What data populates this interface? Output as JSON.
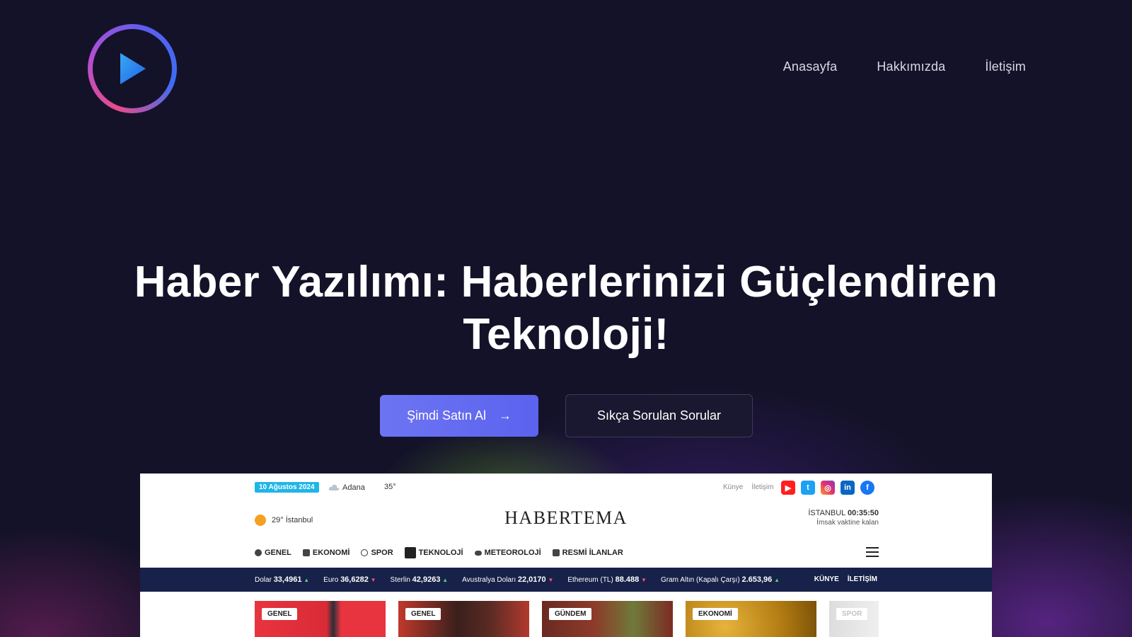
{
  "nav": {
    "items": [
      "Anasayfa",
      "Hakkımızda",
      "İletişim"
    ]
  },
  "hero": {
    "title_line1": "Haber Yazılımı: Haberlerinizi Güçlendiren",
    "title_line2": "Teknoloji!",
    "primary_button": "Şimdi Satın Al",
    "primary_button_arrow": "→",
    "secondary_button": "Sıkça Sorulan Sorular"
  },
  "preview": {
    "date_badge": "10 Ağustos 2024",
    "city": "Adana",
    "temp": "35°",
    "top_links": [
      "Künye",
      "İletişim"
    ],
    "weather": "29° İstanbul",
    "brand": "HABERTEMA",
    "clock_city": "İSTANBUL",
    "clock_time": "00:35:50",
    "clock_caption": "İmsak vaktine kalan",
    "menu": [
      "GENEL",
      "EKONOMİ",
      "SPOR",
      "TEKNOLOJİ",
      "METEOROLOJİ",
      "RESMİ İLANLAR"
    ],
    "ticker": [
      {
        "label": "Dolar",
        "value": "33,4961",
        "dir": "up"
      },
      {
        "label": "Euro",
        "value": "36,6282",
        "dir": "down"
      },
      {
        "label": "Sterlin",
        "value": "42,9263",
        "dir": "up"
      },
      {
        "label": "Avustralya Doları",
        "value": "22,0170",
        "dir": "down"
      },
      {
        "label": "Ethereum (TL)",
        "value": "88.488",
        "dir": "down"
      },
      {
        "label": "Gram Altın (Kapalı Çarşı)",
        "value": "2.653,96",
        "dir": "up"
      }
    ],
    "ticker_links": [
      "KÜNYE",
      "İLETİŞİM"
    ],
    "cards": [
      "GENEL",
      "GENEL",
      "GÜNDEM",
      "EKONOMİ",
      "SPOR"
    ]
  },
  "colors": {
    "background": "#141229",
    "primary_button": "#6369f0",
    "ticker_bg": "#172149",
    "date_badge": "#1fb5e8"
  }
}
